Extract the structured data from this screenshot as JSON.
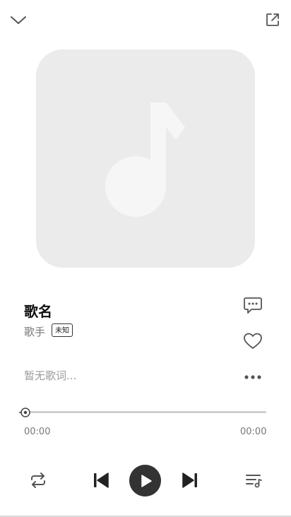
{
  "header": {
    "collapse_icon": "chevron-down-icon",
    "share_icon": "external-link-icon"
  },
  "cover": {
    "placeholder_icon": "music-note-icon"
  },
  "song": {
    "title": "歌名",
    "artist": "歌手",
    "quality_badge": "未知"
  },
  "lyrics": {
    "placeholder": "暂无歌词..."
  },
  "progress": {
    "current_time": "00:00",
    "total_time": "00:00",
    "progress": 0
  },
  "side_actions": {
    "comment_icon": "comment-icon",
    "like_icon": "heart-icon",
    "more_icon": "more-dots-icon"
  },
  "controls": {
    "repeat_icon": "repeat-icon",
    "prev_icon": "skip-previous-icon",
    "play_icon": "play-icon",
    "next_icon": "skip-next-icon",
    "playlist_icon": "playlist-icon"
  },
  "colors": {
    "icon": "#555555",
    "accent_dark": "#333333",
    "cover_bg": "#ebebeb",
    "note": "#f6f6f6"
  }
}
